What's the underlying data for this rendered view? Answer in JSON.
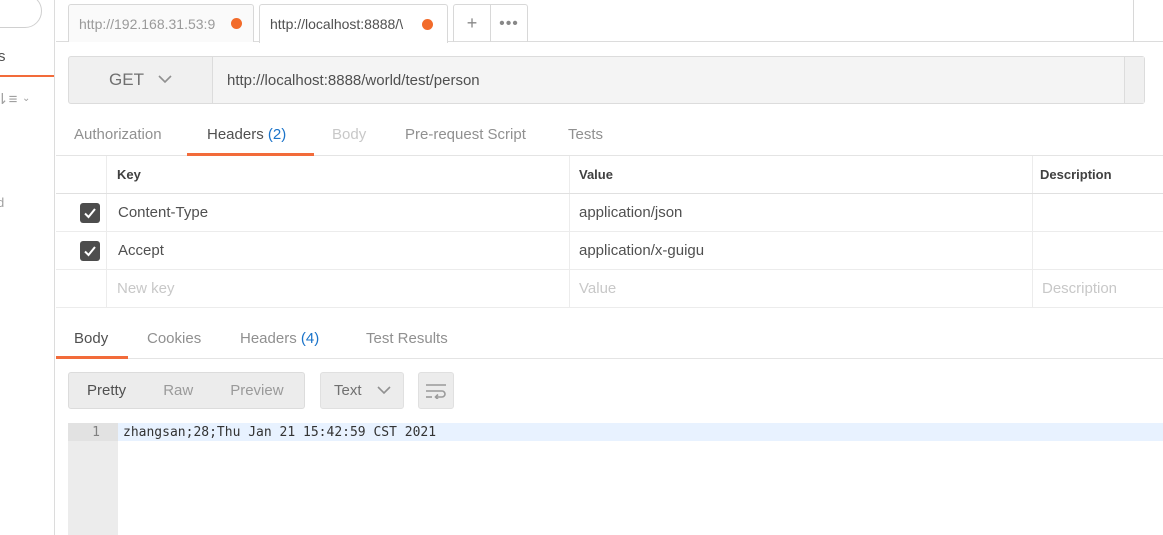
{
  "sidebar": {
    "tab_fragment": "s",
    "sort_icon": "sort-icon",
    "fragment_d": "d"
  },
  "tabs": [
    {
      "label": "http://192.168.31.53:9",
      "unsaved": true,
      "active": false
    },
    {
      "label": "http://localhost:8888/\\",
      "unsaved": true,
      "active": true
    }
  ],
  "tab_actions": {
    "add": "+",
    "more": "•••"
  },
  "colors": {
    "accent": "#f26b3a",
    "unsaved_dot": "#f26b2a",
    "count_blue": "#1a73c9"
  },
  "request": {
    "method": "GET",
    "url": "http://localhost:8888/world/test/person"
  },
  "request_tabs": {
    "authorization": "Authorization",
    "headers": "Headers",
    "headers_count": "(2)",
    "body": "Body",
    "prerequest": "Pre-request Script",
    "tests": "Tests"
  },
  "headers_table": {
    "columns": {
      "key": "Key",
      "value": "Value",
      "description": "Description"
    },
    "rows": [
      {
        "checked": true,
        "key": "Content-Type",
        "value": "application/json",
        "description": ""
      },
      {
        "checked": true,
        "key": "Accept",
        "value": "application/x-guigu",
        "description": ""
      }
    ],
    "new_row": {
      "key_placeholder": "New key",
      "value_placeholder": "Value",
      "description_placeholder": "Description"
    }
  },
  "response_tabs": {
    "body": "Body",
    "cookies": "Cookies",
    "headers": "Headers",
    "headers_count": "(4)",
    "test_results": "Test Results"
  },
  "response_toolbar": {
    "pretty": "Pretty",
    "raw": "Raw",
    "preview": "Preview",
    "format": "Text",
    "wrap_icon": "wrap-lines-icon"
  },
  "response_body": {
    "lines": [
      {
        "number": "1",
        "text": "zhangsan;28;Thu Jan 21 15:42:59 CST 2021"
      }
    ]
  }
}
